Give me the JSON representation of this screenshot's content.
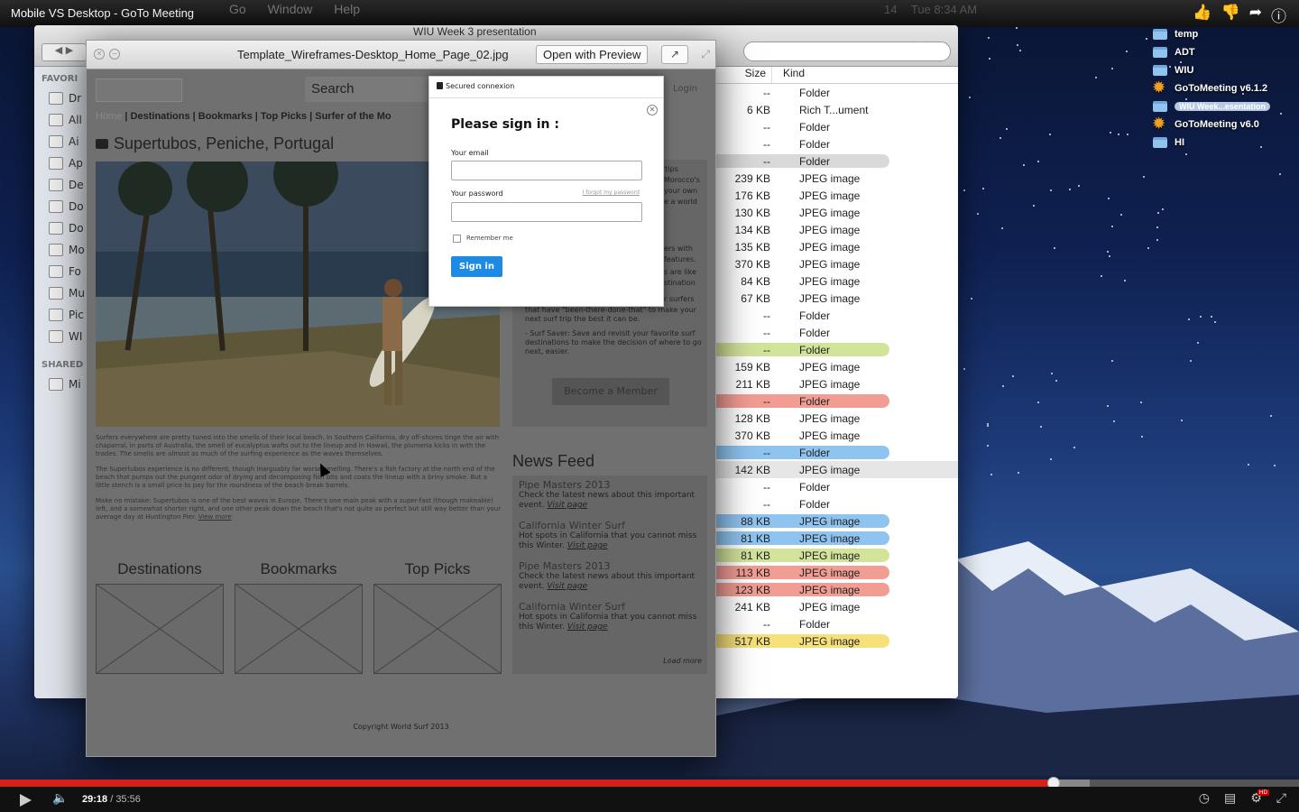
{
  "video": {
    "title": "Mobile VS Desktop - GoTo Meeting",
    "current_time": "29:18",
    "duration": "35:56",
    "played_fraction": 0.811,
    "buffered_fraction": 0.839,
    "hd_label": "HD"
  },
  "mac_menu": [
    "Go",
    "Window",
    "Help"
  ],
  "mac_status": {
    "battery": "14",
    "clock": "Tue 8:34 AM"
  },
  "desktop": {
    "items": [
      {
        "label": "temp",
        "icon": "folder-icon"
      },
      {
        "label": "ADT",
        "icon": "folder-icon"
      },
      {
        "label": "WIU",
        "icon": "folder-icon"
      },
      {
        "label": "GoToMeeting v6.1.2",
        "icon": "gotomeeting-icon"
      },
      {
        "label": "WIU Week...esentation",
        "icon": "folder-icon",
        "selected": true
      },
      {
        "label": "GoToMeeting v6.0",
        "icon": "gotomeeting-icon"
      },
      {
        "label": "HI",
        "icon": "folder-icon"
      }
    ]
  },
  "finder": {
    "title": "WIU Week 3 presentation",
    "sidebar": {
      "favorites_label": "FAVORI",
      "shared_label": "SHARED",
      "items": [
        "Dr",
        "All",
        "Ai",
        "Ap",
        "De",
        "Do",
        "Do",
        "Mo",
        "Fo",
        "Mu",
        "Pic",
        "WI"
      ],
      "shared_items": [
        "Mi"
      ]
    },
    "columns": {
      "size": "Size",
      "kind": "Kind"
    },
    "rows": [
      {
        "size": "--",
        "kind": "Folder",
        "color": ""
      },
      {
        "size": "6 KB",
        "kind": "Rich T...ument",
        "color": ""
      },
      {
        "size": "--",
        "kind": "Folder",
        "color": ""
      },
      {
        "size": "--",
        "kind": "Folder",
        "color": ""
      },
      {
        "size": "--",
        "kind": "Folder",
        "color": "#d9d9d9"
      },
      {
        "size": "239 KB",
        "kind": "JPEG image",
        "color": ""
      },
      {
        "size": "176 KB",
        "kind": "JPEG image",
        "color": ""
      },
      {
        "size": "130 KB",
        "kind": "JPEG image",
        "color": ""
      },
      {
        "size": "134 KB",
        "kind": "JPEG image",
        "color": ""
      },
      {
        "size": "135 KB",
        "kind": "JPEG image",
        "color": ""
      },
      {
        "size": "370 KB",
        "kind": "JPEG image",
        "color": ""
      },
      {
        "size": "84 KB",
        "kind": "JPEG image",
        "color": ""
      },
      {
        "size": "67 KB",
        "kind": "JPEG image",
        "color": ""
      },
      {
        "size": "--",
        "kind": "Folder",
        "color": ""
      },
      {
        "size": "--",
        "kind": "Folder",
        "color": ""
      },
      {
        "size": "--",
        "kind": "Folder",
        "color": "#d2e39a"
      },
      {
        "size": "159 KB",
        "kind": "JPEG image",
        "color": ""
      },
      {
        "size": "211 KB",
        "kind": "JPEG image",
        "color": ""
      },
      {
        "size": "--",
        "kind": "Folder",
        "color": "#f29d94"
      },
      {
        "size": "128 KB",
        "kind": "JPEG image",
        "color": ""
      },
      {
        "size": "370 KB",
        "kind": "JPEG image",
        "color": ""
      },
      {
        "size": "--",
        "kind": "Folder",
        "color": "#8fc4f0"
      },
      {
        "size": "142 KB",
        "kind": "JPEG image",
        "color": "",
        "grey": true
      },
      {
        "size": "--",
        "kind": "Folder",
        "color": ""
      },
      {
        "size": "--",
        "kind": "Folder",
        "color": ""
      },
      {
        "size": "88 KB",
        "kind": "JPEG image",
        "color": "#8fc4f0"
      },
      {
        "size": "81 KB",
        "kind": "JPEG image",
        "color": "#8fc4f0"
      },
      {
        "size": "81 KB",
        "kind": "JPEG image",
        "color": "#d2e39a"
      },
      {
        "size": "113 KB",
        "kind": "JPEG image",
        "color": "#f29d94"
      },
      {
        "size": "123 KB",
        "kind": "JPEG image",
        "color": "#f29d94"
      },
      {
        "size": "241 KB",
        "kind": "JPEG image",
        "color": ""
      },
      {
        "size": "--",
        "kind": "Folder",
        "color": ""
      },
      {
        "size": "517 KB",
        "kind": "JPEG image",
        "color": "#f5e07a"
      }
    ]
  },
  "preview": {
    "filename": "Template_Wireframes-Desktop_Home_Page_02.jpg",
    "open_with": "Open with Preview",
    "wireframe": {
      "search": "Search",
      "login": "Login",
      "nav": {
        "home": "Home",
        "items": [
          "Destinations",
          "Bookmarks",
          "Top Picks",
          "Surfer of the Mo"
        ]
      },
      "heading": "Supertubos, Peniche, Portugal",
      "body": [
        "Surfers everywhere are pretty tuned into the smells of their local beach. In Southern California, dry off-shores tinge the air with chaparral, in parts of Australia, the smell of eucalyptus wafts out to the lineup and in Hawaii, the plumeria kicks in with the trades. The smells are almost as much of the surfing experience as the waves themselves.",
        "The Supertubos experience is no different, though inarguably far worse smelling. There's a fish factory at the north end of the beach that pumps out the pungent odor of drying and decomposing fish bits and coats the lineup with a briny smoke. But a little stench is a small price to pay for the roundness of the beach break barrels.",
        "Make no mistake: Supertubos is one of the best waves in Europe. There's one main peak with a super-fast (though makeable) left, and a somewhat shorter right, and one other peak down the beach that's not quite as perfect but still way better than your average day at Huntington Pier."
      ],
      "view_more": "View more",
      "right_panel": {
        "lines": [
          "rtips",
          "Morocco's",
          "your own",
          "e a world",
          "ers with",
          "features.",
          "s are like",
          "stination",
          "r surfers"
        ],
        "tail": "that have \"been-there-done-that\" to make your next surf trip the best it can be.",
        "surf_saver": "- Surf Saver: Save and revisit your favorite surf destinations to make the decision of where to go next, easier.",
        "member_button": "Become a Member"
      },
      "news": {
        "heading": "News Feed",
        "items": [
          {
            "title": "Pipe Masters 2013",
            "desc": "Check the latest news about this important event.",
            "link": "Visit page"
          },
          {
            "title": "California Winter Surf",
            "desc": "Hot spots in California that you cannot miss this Winter.",
            "link": "Visit page"
          },
          {
            "title": "Pipe Masters 2013",
            "desc": "Check the latest news about this important event.",
            "link": "Visit page"
          },
          {
            "title": "California Winter Surf",
            "desc": "Hot spots in California that you cannot miss this Winter.",
            "link": "Visit page"
          }
        ],
        "load_more": "Load more"
      },
      "cards": [
        "Destinations",
        "Bookmarks",
        "Top Picks"
      ],
      "footer": "Copyright World Surf 2013"
    },
    "modal": {
      "secured": "Secured connexion",
      "title": "Please sign in :",
      "email_label": "Your email",
      "password_label": "Your password",
      "forgot": "I forgot my password",
      "remember": "Remember me",
      "sign_in": "Sign in"
    }
  }
}
